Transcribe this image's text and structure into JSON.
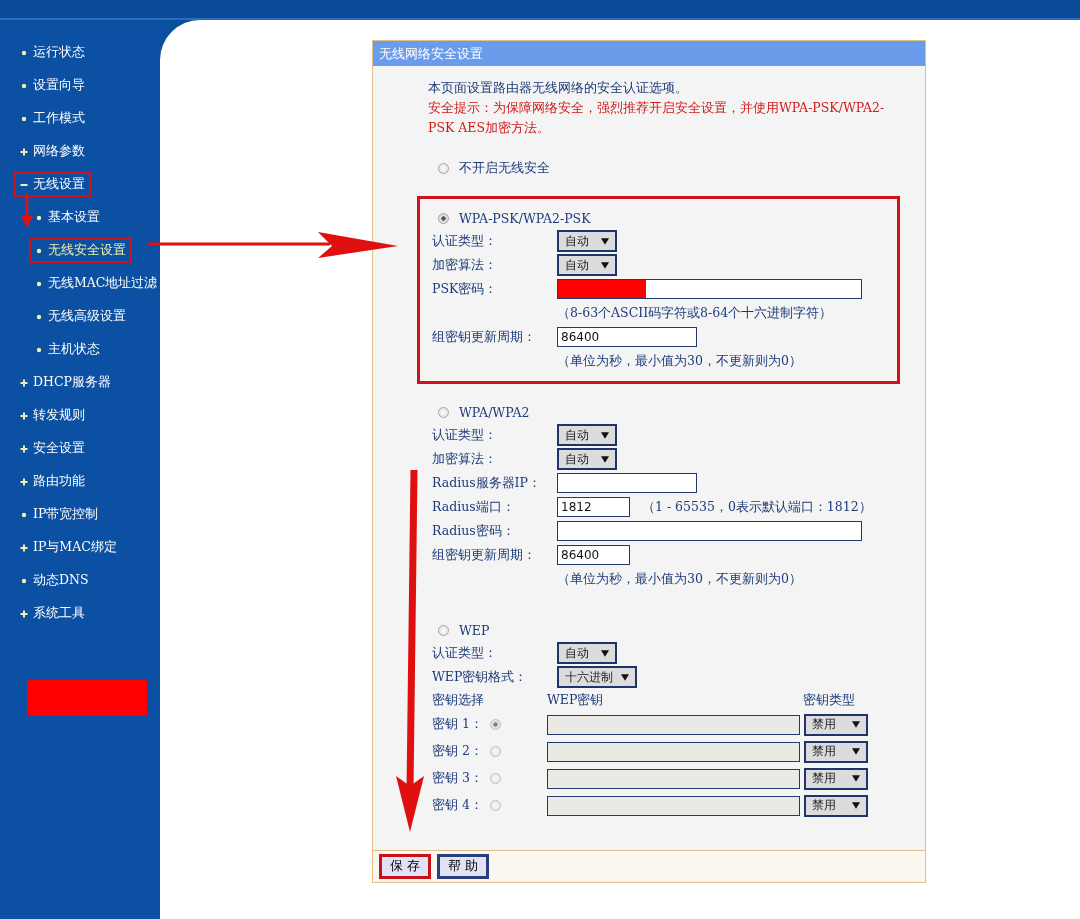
{
  "sidebar": {
    "items": [
      {
        "label": "运行状态",
        "kind": "link",
        "selected": false,
        "highlighted": false
      },
      {
        "label": "设置向导",
        "kind": "link",
        "selected": false,
        "highlighted": false
      },
      {
        "label": "工作模式",
        "kind": "link",
        "selected": false,
        "highlighted": false
      },
      {
        "label": "网络参数",
        "kind": "folder",
        "expanded": false,
        "selected": false,
        "highlighted": false
      },
      {
        "label": "无线设置",
        "kind": "folder",
        "expanded": true,
        "selected": false,
        "highlighted": true,
        "children": [
          {
            "label": "基本设置",
            "selected": false,
            "highlighted": false
          },
          {
            "label": "无线安全设置",
            "selected": true,
            "highlighted": true
          },
          {
            "label": "无线MAC地址过滤",
            "selected": false,
            "highlighted": false
          },
          {
            "label": "无线高级设置",
            "selected": false,
            "highlighted": false
          },
          {
            "label": "主机状态",
            "selected": false,
            "highlighted": false
          }
        ]
      },
      {
        "label": "DHCP服务器",
        "kind": "folder",
        "expanded": false,
        "selected": false,
        "highlighted": false
      },
      {
        "label": "转发规则",
        "kind": "folder",
        "expanded": false,
        "selected": false,
        "highlighted": false
      },
      {
        "label": "安全设置",
        "kind": "folder",
        "expanded": false,
        "selected": false,
        "highlighted": false
      },
      {
        "label": "路由功能",
        "kind": "folder",
        "expanded": false,
        "selected": false,
        "highlighted": false
      },
      {
        "label": "IP带宽控制",
        "kind": "link",
        "selected": false,
        "highlighted": false
      },
      {
        "label": "IP与MAC绑定",
        "kind": "folder",
        "expanded": false,
        "selected": false,
        "highlighted": false
      },
      {
        "label": "动态DNS",
        "kind": "link",
        "selected": false,
        "highlighted": false
      },
      {
        "label": "系统工具",
        "kind": "folder",
        "expanded": false,
        "selected": false,
        "highlighted": false
      }
    ]
  },
  "panel": {
    "title": "无线网络安全设置",
    "intro": "本页面设置路由器无线网络的安全认证选项。",
    "warning": "安全提示：为保障网络安全，强烈推荐开启安全设置，并使用WPA-PSK/WPA2-PSK AES加密方法。",
    "options": [
      {
        "label": "不开启无线安全",
        "kind": "plain",
        "selected": false,
        "highlighted": false
      },
      {
        "label": "WPA-PSK/WPA2-PSK",
        "kind": "fields",
        "selected": true,
        "highlighted": true,
        "rows": [
          {
            "label": "认证类型：",
            "kind": "select",
            "value": "自动"
          },
          {
            "label": "加密算法：",
            "kind": "select",
            "value": "自动"
          },
          {
            "label": "PSK密码：",
            "kind": "long-input",
            "redacted": true
          },
          {
            "kind": "note",
            "text": "（8-63个ASCII码字符或8-64个十六进制字符）"
          },
          {
            "label": "组密钥更新周期：",
            "kind": "input",
            "value": "86400"
          },
          {
            "kind": "note",
            "text": "（单位为秒，最小值为30，不更新则为0）"
          }
        ]
      },
      {
        "label": "WPA/WPA2",
        "kind": "fields",
        "selected": false,
        "highlighted": false,
        "rows": [
          {
            "label": "认证类型：",
            "kind": "select",
            "value": "自动"
          },
          {
            "label": "加密算法：",
            "kind": "select",
            "value": "自动"
          },
          {
            "label": "Radius服务器IP：",
            "kind": "input"
          },
          {
            "label": "Radius端口：",
            "kind": "short-input",
            "value": "1812",
            "hint": "（1 - 65535，0表示默认端口：1812）"
          },
          {
            "label": "Radius密码：",
            "kind": "long-input"
          },
          {
            "label": "组密钥更新周期：",
            "kind": "short-input",
            "value": "86400"
          },
          {
            "kind": "note",
            "text": "（单位为秒，最小值为30，不更新则为0）"
          }
        ]
      },
      {
        "label": "WEP",
        "kind": "wep",
        "selected": false,
        "highlighted": false,
        "rows": [
          {
            "label": "认证类型：",
            "kind": "select",
            "value": "自动"
          },
          {
            "label": "WEP密钥格式：",
            "kind": "select",
            "value": "十六进制"
          }
        ],
        "key_columns": [
          "密钥选择",
          "WEP密钥",
          "密钥类型"
        ],
        "keys": [
          {
            "label": "密钥 1：",
            "selected": true,
            "disabled": true,
            "type": "禁用"
          },
          {
            "label": "密钥 2：",
            "selected": false,
            "disabled": true,
            "type": "禁用"
          },
          {
            "label": "密钥 3：",
            "selected": false,
            "disabled": true,
            "type": "禁用"
          },
          {
            "label": "密钥 4：",
            "selected": false,
            "disabled": true,
            "type": "禁用"
          }
        ]
      }
    ],
    "buttons": [
      {
        "label": "保 存",
        "highlighted": true
      },
      {
        "label": "帮 助",
        "highlighted": false
      }
    ]
  }
}
